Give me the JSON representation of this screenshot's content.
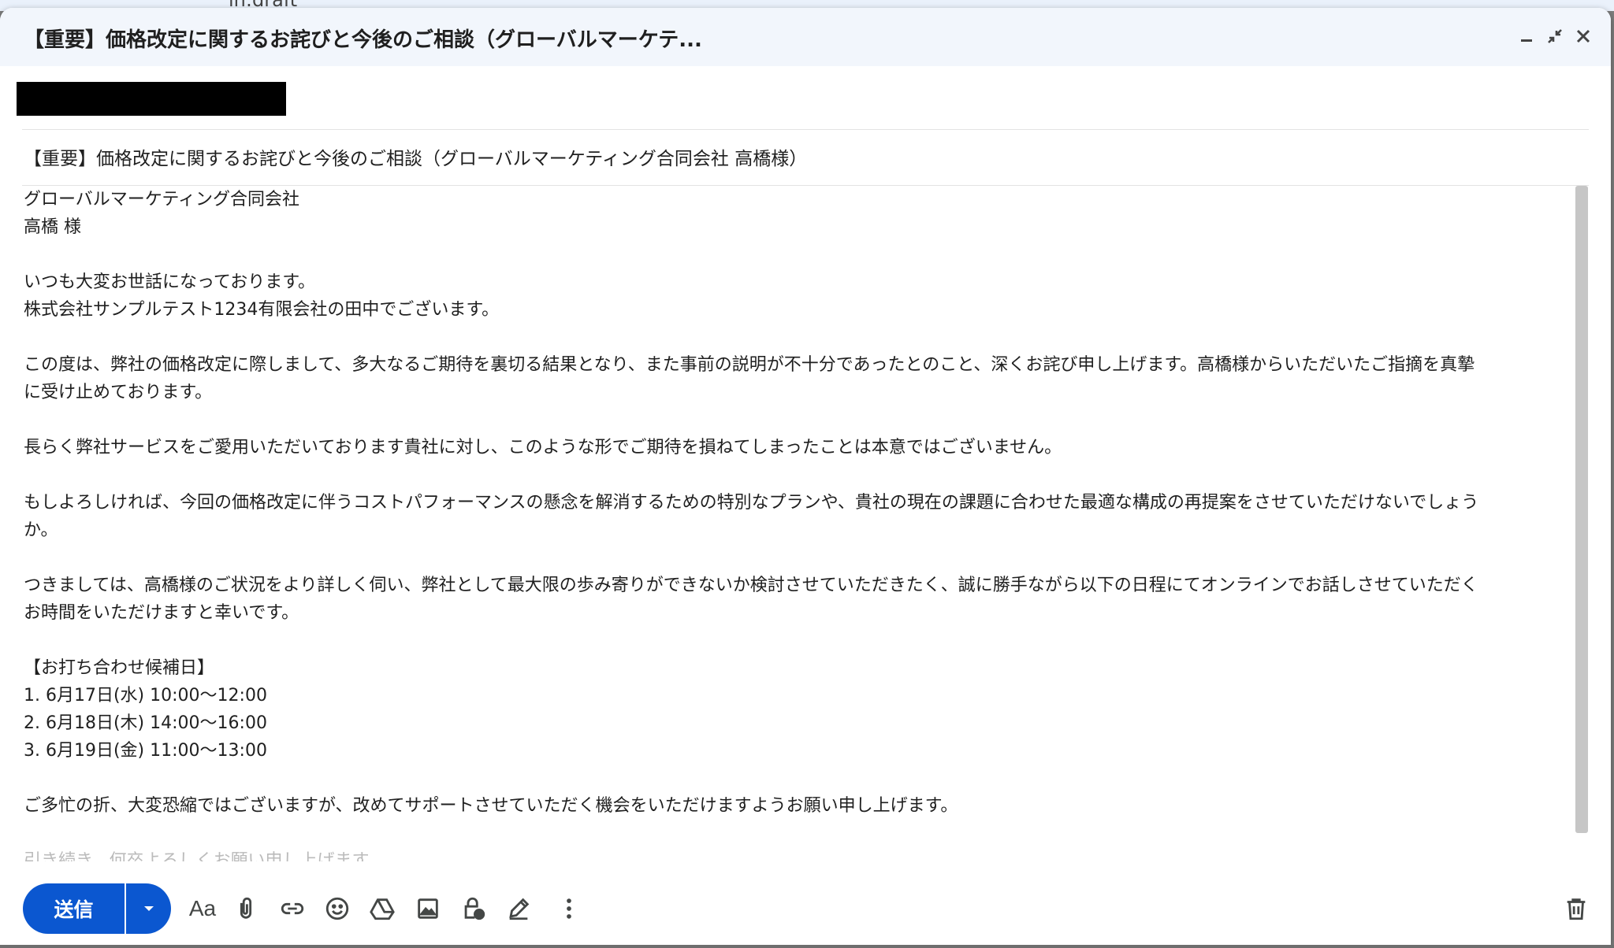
{
  "background": {
    "text": "in:draft"
  },
  "compose": {
    "window_title": "【重要】価格改定に関するお詫びと今後のご相談（グローバルマーケテ...",
    "subject": "【重要】価格改定に関するお詫びと今後のご相談（グローバルマーケティング合同会社 高橋様）",
    "body_lines": [
      "グローバルマーケティング合同会社",
      "高橋 様",
      "",
      "いつも大変お世話になっております。",
      "株式会社サンプルテスト1234有限会社の田中でございます。",
      "",
      "この度は、弊社の価格改定に際しまして、多大なるご期待を裏切る結果となり、また事前の説明が不十分であったとのこと、深くお詫び申し上げます。高橋様からいただいたご指摘を真摯",
      "に受け止めております。",
      "",
      "長らく弊社サービスをご愛用いただいております貴社に対し、このような形でご期待を損ねてしまったことは本意ではございません。",
      "",
      "もしよろしければ、今回の価格改定に伴うコストパフォーマンスの懸念を解消するための特別なプランや、貴社の現在の課題に合わせた最適な構成の再提案をさせていただけないでしょう",
      "か。",
      "",
      "つきましては、高橋様のご状況をより詳しく伺い、弊社として最大限の歩み寄りができないか検討させていただきたく、誠に勝手ながら以下の日程にてオンラインでお話しさせていただく",
      "お時間をいただけますと幸いです。",
      "",
      "【お打ち合わせ候補日】",
      "1. 6月17日(水) 10:00〜12:00",
      "2. 6月18日(木) 14:00〜16:00",
      "3. 6月19日(金) 11:00〜13:00",
      "",
      "ご多忙の折、大変恐縮ではございますが、改めてサポートさせていただく機会をいただけますようお願い申し上げます。",
      "",
      "引き続き、何卒よろしくお願い申し上げます。"
    ]
  },
  "toolbar": {
    "send_label": "送信",
    "format_label": "Aa"
  },
  "icons": {
    "minimize": "minimize-icon",
    "exit_fullscreen": "exit-fullscreen-icon",
    "close": "close-icon",
    "send_options": "chevron-down-icon",
    "format": "text-format-icon",
    "attach": "paperclip-icon",
    "link": "link-icon",
    "emoji": "emoji-icon",
    "drive": "drive-icon",
    "photo": "photo-icon",
    "confidential": "lock-clock-icon",
    "signature": "pen-icon",
    "more": "more-vert-icon",
    "discard": "trash-icon"
  },
  "colors": {
    "send_button": "#0b57d0",
    "titlebar": "#f2f6fc"
  }
}
